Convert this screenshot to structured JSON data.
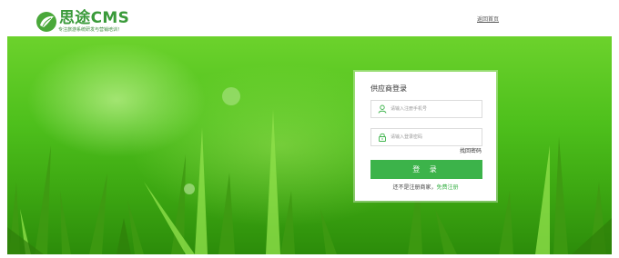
{
  "header": {
    "logo_title": "思途CMS",
    "logo_slogan": "专注旅游系统研发与营销培训！",
    "home_link": "返回首页"
  },
  "login": {
    "title": "供应商登录",
    "phone_placeholder": "请输入注册手机号",
    "password_placeholder": "请输入登录密码",
    "forgot_password": "找回密码",
    "submit_label": "登 录",
    "register_prompt": "还不是注册商家，",
    "register_link": "免费注册"
  },
  "colors": {
    "brand_green": "#3a9a3a",
    "button_green": "#3cb34a",
    "banner_green": "#4ec01c"
  },
  "icons": {
    "logo": "leaf-logo-icon",
    "phone": "user-icon",
    "password": "lock-icon"
  }
}
